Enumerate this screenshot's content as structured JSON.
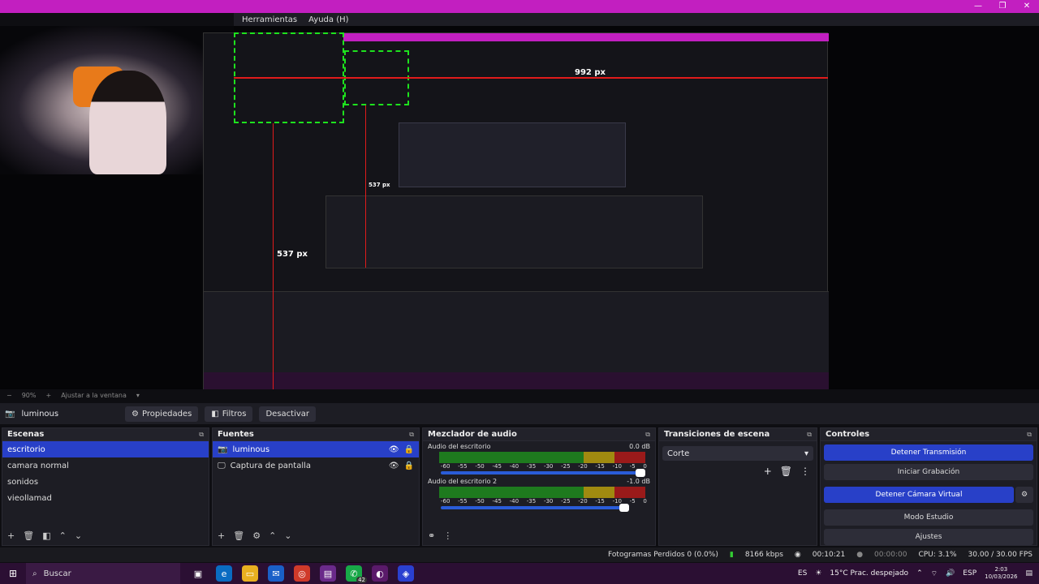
{
  "window": {
    "controls": [
      "—",
      "❐",
      "✕"
    ]
  },
  "menu": {
    "items": [
      "Herramientas",
      "Ayuda (H)"
    ]
  },
  "preview": {
    "measure_top": "992 px",
    "measure_mid": "537 px",
    "measure_left": "537 px"
  },
  "zoombar": {
    "zoom": "90%",
    "fit_label": "Ajustar a la ventana"
  },
  "source_bar": {
    "source_name": "luminous",
    "properties_label": "Propiedades",
    "filters_label": "Filtros",
    "deactivate_label": "Desactivar"
  },
  "scenes": {
    "title": "Escenas",
    "items": [
      {
        "label": "escritorio",
        "selected": true
      },
      {
        "label": "camara normal",
        "selected": false
      },
      {
        "label": "sonidos",
        "selected": false
      },
      {
        "label": "vieollamad",
        "selected": false
      }
    ]
  },
  "sources": {
    "title": "Fuentes",
    "items": [
      {
        "label": "luminous",
        "selected": true
      },
      {
        "label": "Captura de pantalla",
        "selected": false
      }
    ]
  },
  "mixer": {
    "title": "Mezclador de audio",
    "ticks": [
      "-60",
      "-55",
      "-50",
      "-45",
      "-40",
      "-35",
      "-30",
      "-25",
      "-20",
      "-15",
      "-10",
      "-5",
      "0"
    ],
    "channels": [
      {
        "name": "Audio del escritorio",
        "db": "0.0 dB",
        "volume": 1.0
      },
      {
        "name": "Audio del escritorio 2",
        "db": "-1.0 dB",
        "volume": 0.92
      }
    ]
  },
  "transitions": {
    "title": "Transiciones de escena",
    "selected": "Corte"
  },
  "controls": {
    "title": "Controles",
    "buttons": [
      {
        "label": "Detener Transmisión",
        "active": true
      },
      {
        "label": "Iniciar Grabación",
        "active": false
      },
      {
        "label": "Detener Cámara Virtual",
        "active": true
      },
      {
        "label": "Modo Estudio",
        "active": false
      },
      {
        "label": "Ajustes",
        "active": false
      }
    ]
  },
  "status": {
    "dropped_frames": "Fotogramas Perdidos 0 (0.0%)",
    "bitrate": "8166 kbps",
    "stream_time": "00:10:21",
    "rec_time": "00:00:00",
    "cpu": "CPU: 3.1%",
    "fps": "30.00 / 30.00 FPS"
  },
  "taskbar": {
    "search_label": "Buscar",
    "language": "ES",
    "weather": "15°C  Prac. despejado",
    "input_lang": "ESP",
    "time": "2:03",
    "date": "10/03/2026",
    "badge": "42"
  },
  "colors": {
    "accent": "#2840c8",
    "titlebar": "#c21fc0",
    "taskbar": "#2b0f33",
    "guide": "#e01b1b",
    "selection": "#1ee21e"
  }
}
